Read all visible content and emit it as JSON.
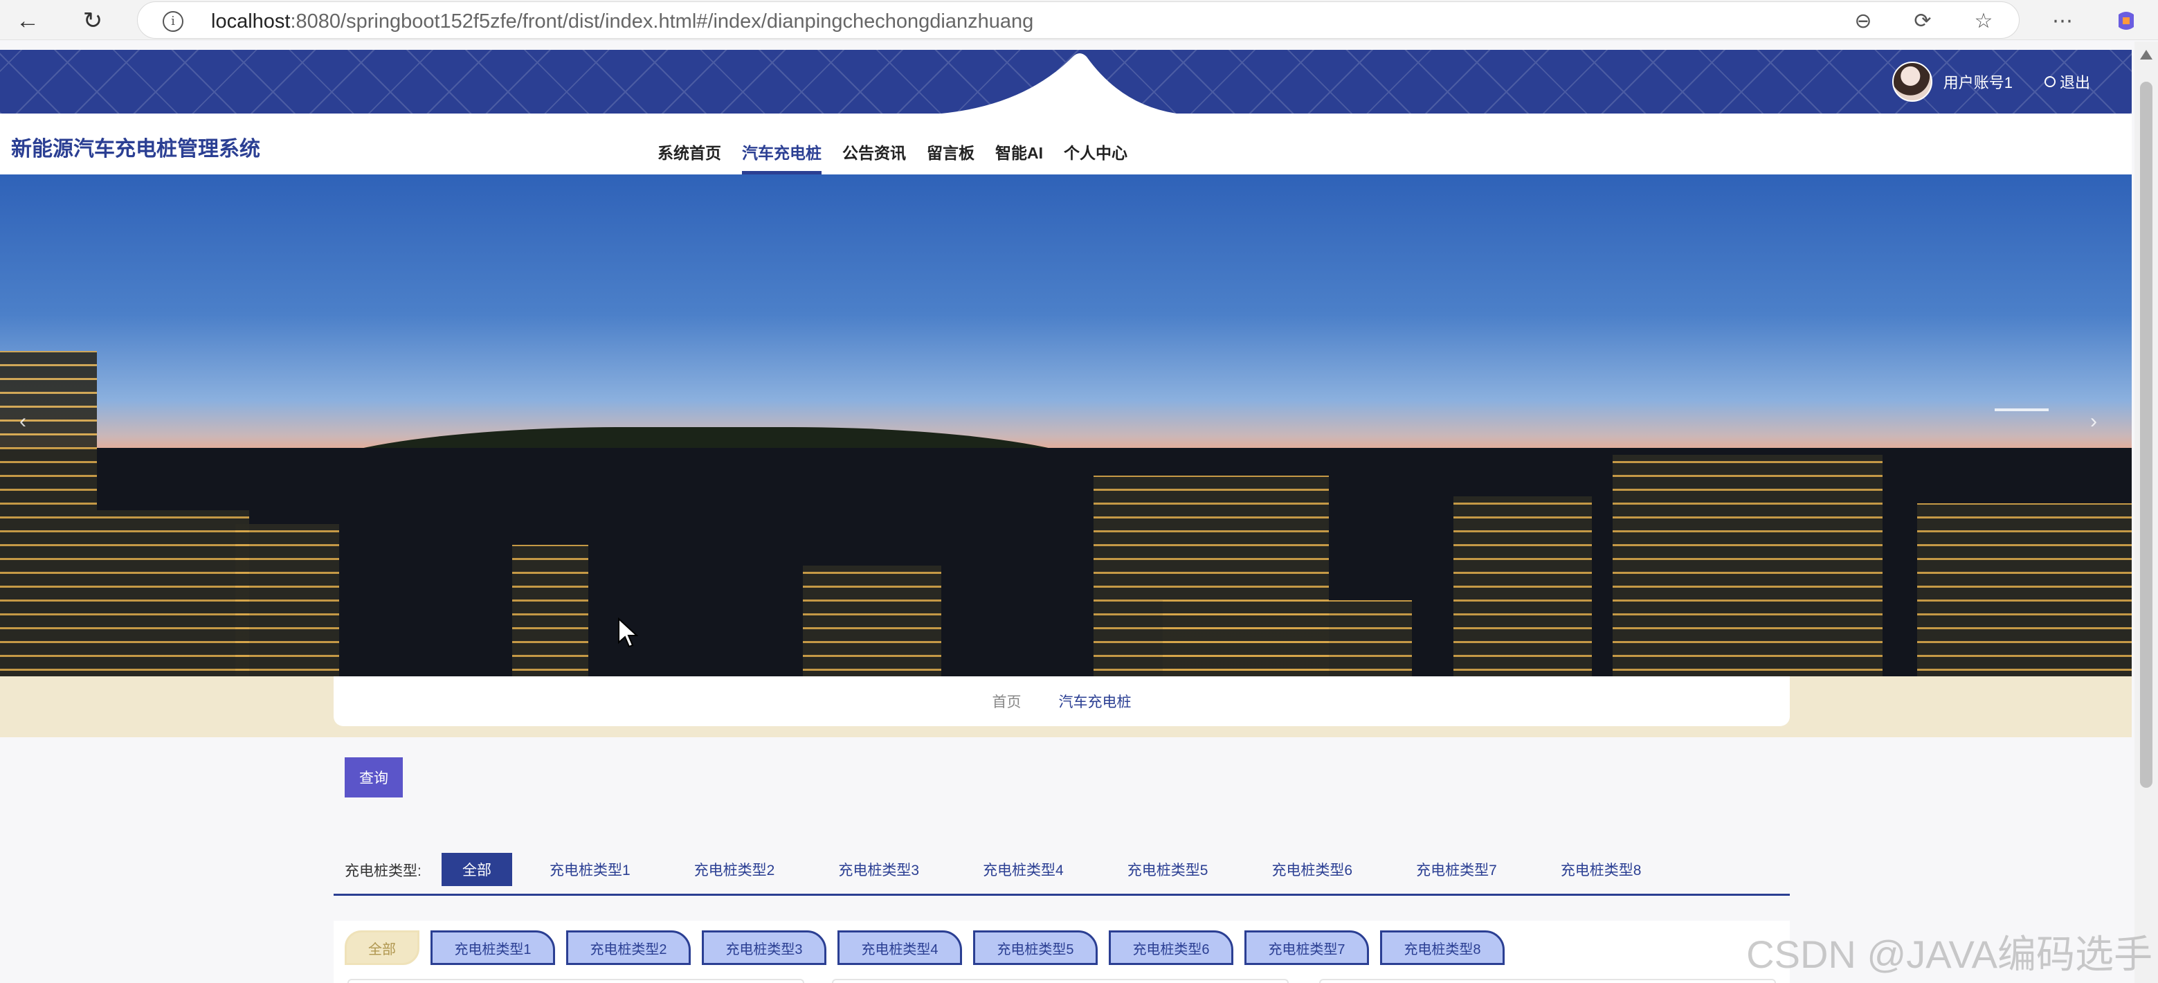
{
  "browser": {
    "url_host": "localhost",
    "url_rest": ":8080/springboot152f5zfe/front/dist/index.html#/index/dianpingchechongdianzhuang"
  },
  "user": {
    "account": "用户账号1",
    "logout": "退出"
  },
  "header": {
    "title": "新能源汽车充电桩管理系统",
    "menu": [
      "系统首页",
      "汽车充电桩",
      "公告资讯",
      "留言板",
      "智能AI",
      "个人中心"
    ],
    "active_menu": "汽车充电桩"
  },
  "breadcrumb": {
    "home": "首页",
    "current": "汽车充电桩"
  },
  "search": {
    "button": "查询"
  },
  "filter": {
    "label": "充电桩类型:",
    "options": [
      "全部",
      "充电桩类型1",
      "充电桩类型2",
      "充电桩类型3",
      "充电桩类型4",
      "充电桩类型5",
      "充电桩类型6",
      "充电桩类型7",
      "充电桩类型8"
    ],
    "active": "全部"
  },
  "tabs": {
    "items": [
      "全部",
      "充电桩类型1",
      "充电桩类型2",
      "充电桩类型3",
      "充电桩类型4",
      "充电桩类型5",
      "充电桩类型6",
      "充电桩类型7",
      "充电桩类型8"
    ]
  },
  "watermark": "CSDN @JAVA编码选手",
  "colors": {
    "primary": "#2b3f93",
    "search_button": "#5b55c9",
    "breadcrumb_band": "#f1e8cf",
    "tab_fill": "#b7c6f5"
  }
}
